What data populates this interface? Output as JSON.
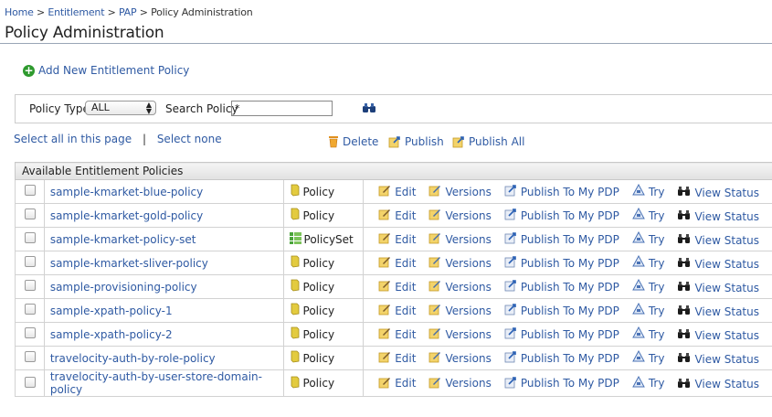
{
  "breadcrumb": {
    "items": [
      "Home",
      "Entitlement",
      "PAP",
      "Policy Administration"
    ],
    "separator": ">"
  },
  "page_title": "Policy Administration",
  "add_policy_label": "Add New Entitlement Policy",
  "filter": {
    "policy_type_label": "Policy Type",
    "policy_type_value": "ALL",
    "search_label": "Search Policy",
    "search_value": "*"
  },
  "selection": {
    "select_all": "Select all in this page",
    "separator": "|",
    "select_none": "Select none"
  },
  "bulk_actions": {
    "delete": "Delete",
    "publish": "Publish",
    "publish_all": "Publish All"
  },
  "table": {
    "header": "Available Entitlement Policies",
    "op_labels": {
      "edit": "Edit",
      "versions": "Versions",
      "publish_pdp": "Publish To My PDP",
      "try": "Try",
      "view_status": "View Status"
    },
    "rows": [
      {
        "name": "sample-kmarket-blue-policy",
        "type": "Policy"
      },
      {
        "name": "sample-kmarket-gold-policy",
        "type": "Policy"
      },
      {
        "name": "sample-kmarket-policy-set",
        "type": "PolicySet"
      },
      {
        "name": "sample-kmarket-sliver-policy",
        "type": "Policy"
      },
      {
        "name": "sample-provisioning-policy",
        "type": "Policy"
      },
      {
        "name": "sample-xpath-policy-1",
        "type": "Policy"
      },
      {
        "name": "sample-xpath-policy-2",
        "type": "Policy"
      },
      {
        "name": "travelocity-auth-by-role-policy",
        "type": "Policy"
      },
      {
        "name": "travelocity-auth-by-user-store-domain-policy",
        "type": "Policy"
      }
    ]
  },
  "colors": {
    "link": "#2f5aa3",
    "add_icon": "#2e9a2e",
    "policy_icon": "#d8c23a",
    "policyset_icon": "#4aa43a"
  },
  "icons": [
    "plus-circle-icon",
    "binoculars-icon",
    "trash-icon",
    "publish-icon",
    "publish-all-icon",
    "policy-icon",
    "policyset-icon",
    "edit-icon",
    "versions-icon",
    "publish-pdp-icon",
    "try-icon",
    "view-status-icon"
  ]
}
